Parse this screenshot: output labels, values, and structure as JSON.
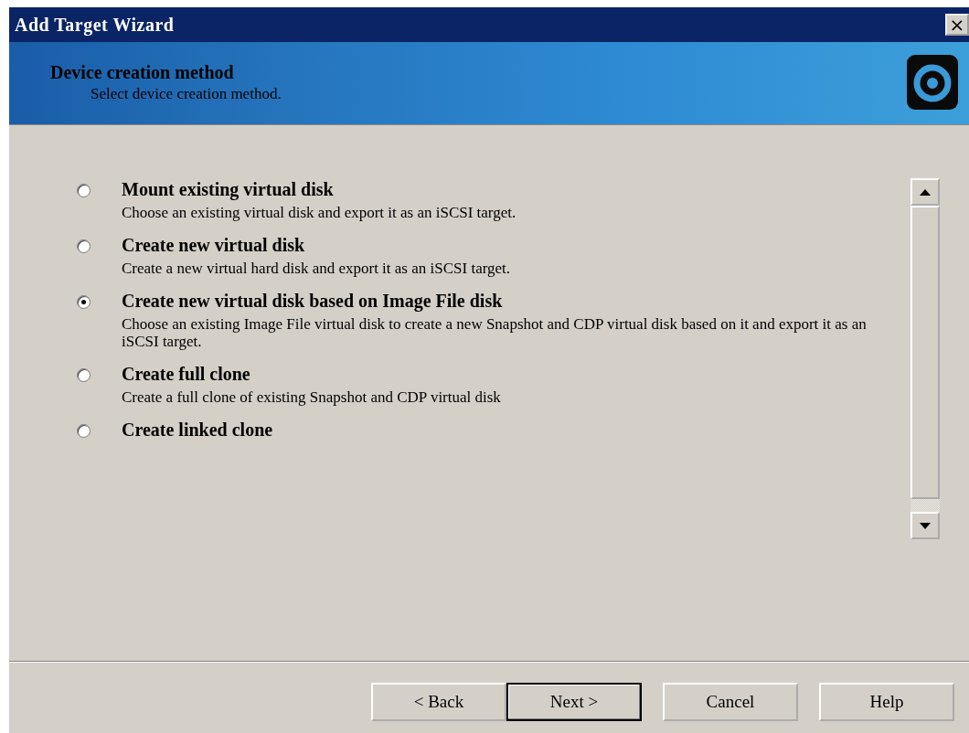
{
  "window": {
    "title": "Add Target Wizard",
    "close": "×"
  },
  "header": {
    "title": "Device creation method",
    "subtitle": "Select device creation method."
  },
  "options": [
    {
      "label": "Mount existing virtual disk",
      "description": "Choose an existing virtual disk and export it as an iSCSI target.",
      "selected": false
    },
    {
      "label": "Create new virtual disk",
      "description": "Create a new virtual hard disk and export it as an iSCSI target.",
      "selected": false
    },
    {
      "label": "Create new virtual disk based on Image File disk",
      "description": "Choose an existing Image File virtual disk to create a new Snapshot and CDP virtual disk based on it and export it as an iSCSI target.",
      "selected": true
    },
    {
      "label": "Create full clone",
      "description": "Create a full clone of existing Snapshot and CDP virtual disk",
      "selected": false
    },
    {
      "label": "Create linked clone",
      "selected": false
    }
  ],
  "buttons": [
    {
      "label": "< Back",
      "default": false
    },
    {
      "label": "Next >",
      "default": true
    },
    {
      "label": "Cancel",
      "default": false
    },
    {
      "label": "Help",
      "default": false
    }
  ]
}
